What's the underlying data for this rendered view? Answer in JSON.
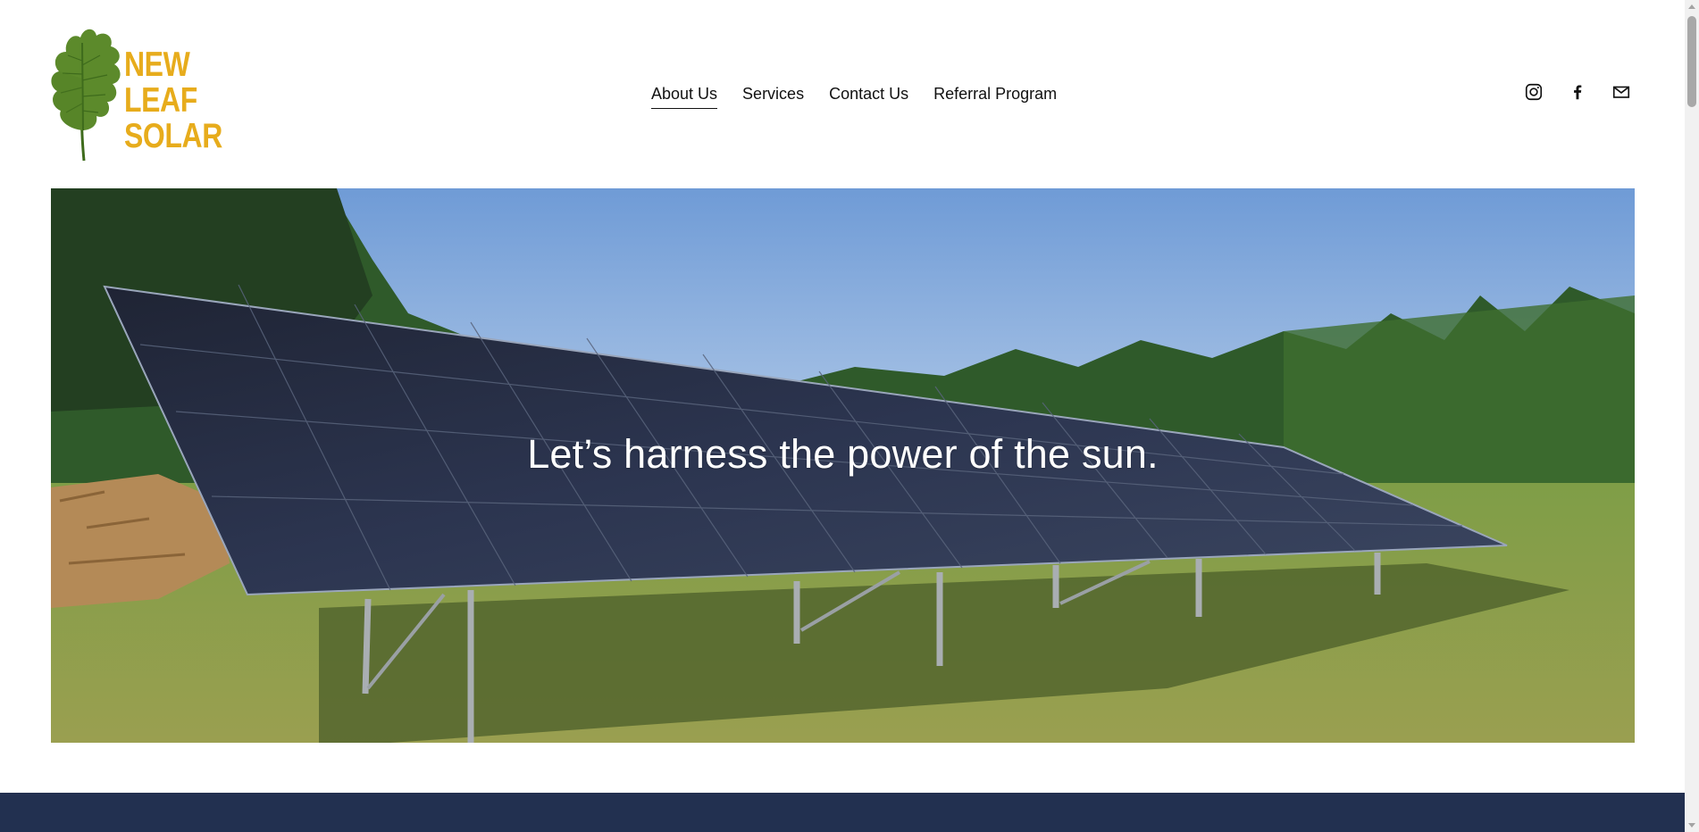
{
  "brand": {
    "logo_lines": [
      "NEW",
      "LEAF",
      "SOLAR"
    ],
    "logo_icon": "oak-leaf-icon",
    "logo_color": "#e7ac1c",
    "leaf_color": "#5c8a2b"
  },
  "nav": {
    "items": [
      {
        "label": "About Us",
        "active": true
      },
      {
        "label": "Services",
        "active": false
      },
      {
        "label": "Contact Us",
        "active": false
      },
      {
        "label": "Referral Program",
        "active": false
      }
    ]
  },
  "social": {
    "icons": [
      "instagram-icon",
      "facebook-icon",
      "email-icon"
    ]
  },
  "hero": {
    "title": "Let’s harness the power of the sun."
  },
  "colors": {
    "footer_band": "#223050",
    "text": "#111111"
  }
}
